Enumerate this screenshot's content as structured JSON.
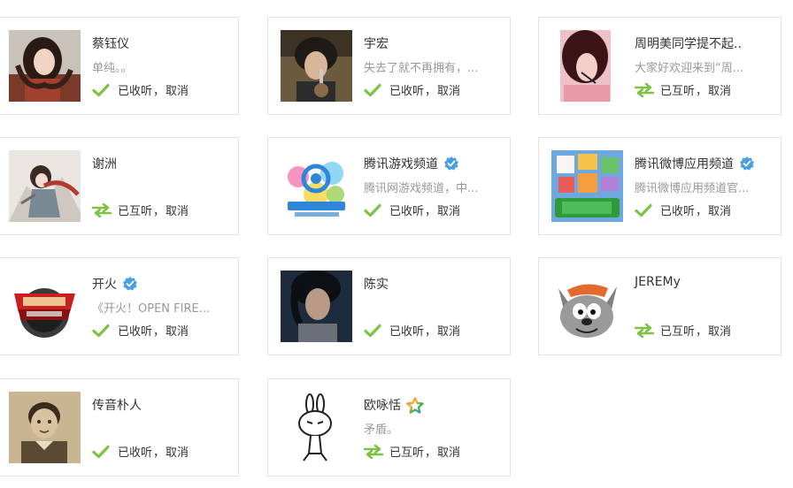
{
  "cards": [
    {
      "name": "蔡钰仪",
      "desc": "单纯。。",
      "status": "已收听",
      "sep": "，",
      "cancel": "取消",
      "mode": "check",
      "badge": "none",
      "avatar": "photo-woman"
    },
    {
      "name": "宇宏",
      "desc": "失去了就不再拥有，...",
      "status": "已收听",
      "sep": "，",
      "cancel": "取消",
      "mode": "check",
      "badge": "none",
      "avatar": "photo-man"
    },
    {
      "name": "周明美同学提不起..",
      "desc": "大家好欢迎来到“周...",
      "status": "已互听",
      "sep": "，",
      "cancel": "取消",
      "mode": "mutual",
      "badge": "none",
      "avatar": "photo-pink"
    },
    {
      "name": "谢洲",
      "desc": "",
      "status": "已互听",
      "sep": "，",
      "cancel": "取消",
      "mode": "mutual",
      "badge": "none",
      "avatar": "anime"
    },
    {
      "name": "腾讯游戏频道",
      "desc": "腾讯网游戏频道，中...",
      "status": "已收听",
      "sep": "，",
      "cancel": "取消",
      "mode": "check",
      "badge": "verified",
      "avatar": "games-logo"
    },
    {
      "name": "腾讯微博应用频道",
      "desc": "腾讯微博应用频道官...",
      "status": "已收听",
      "sep": "，",
      "cancel": "取消",
      "mode": "check",
      "badge": "verified",
      "avatar": "apps-logo"
    },
    {
      "name": "开火",
      "desc": "《开火！OPEN FIRE...",
      "status": "已收听",
      "sep": "，",
      "cancel": "取消",
      "mode": "check",
      "badge": "verified",
      "avatar": "openfire-logo"
    },
    {
      "name": "陈实",
      "desc": "",
      "status": "已收听",
      "sep": "，",
      "cancel": "取消",
      "mode": "check",
      "badge": "none",
      "avatar": "photo-dark"
    },
    {
      "name": "JEREMy",
      "desc": "",
      "status": "已互听",
      "sep": "，",
      "cancel": "取消",
      "mode": "mutual",
      "badge": "none",
      "avatar": "wolf"
    },
    {
      "name": "传音朴人",
      "desc": "",
      "status": "已收听",
      "sep": "，",
      "cancel": "取消",
      "mode": "check",
      "badge": "none",
      "avatar": "photo-boy"
    },
    {
      "name": "欧咏恬",
      "desc": "矛盾。",
      "status": "已互听",
      "sep": "，",
      "cancel": "取消",
      "mode": "mutual",
      "badge": "star",
      "avatar": "rabbit"
    }
  ],
  "colors": {
    "check": "#7dc242",
    "verified": "#4a9fe0",
    "name": "#333333",
    "desc": "#999999"
  }
}
